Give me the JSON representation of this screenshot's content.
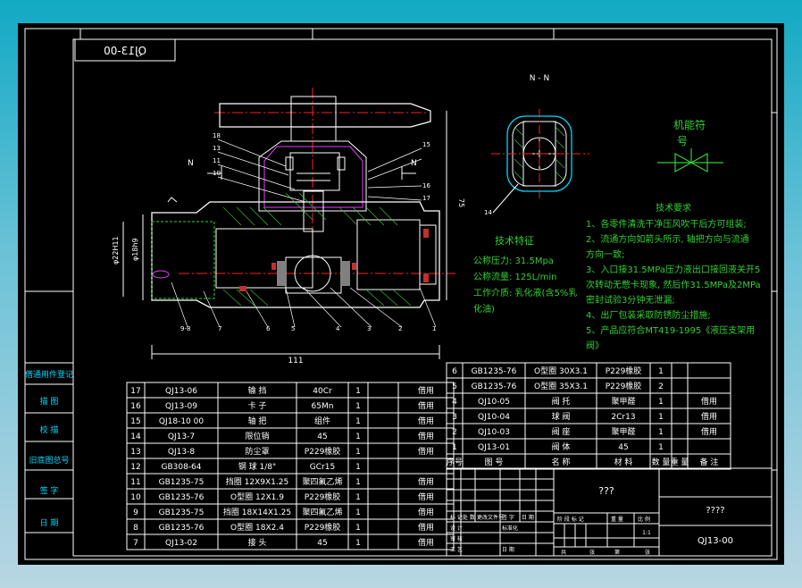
{
  "drawing_code": "QJ13-00",
  "drawing_code_mirrored": "QJ13-00",
  "section_label": "N - N",
  "cut_labels": {
    "left": "N",
    "right": "N"
  },
  "symbol_title_line1": "机能符",
  "symbol_title_line2": "号",
  "tech_features": {
    "title": "技术特征",
    "lines": [
      "公称压力: 31.5Mpa",
      "公称流量: 125L/min",
      "工作介质: 乳化液(含5%乳",
      "化油)"
    ]
  },
  "tech_requirements": {
    "title": "技术要求",
    "lines": [
      "1、各零件清洗干净压风吹干后方可组装;",
      "2、流通方向如箭头所示, 轴把方向与流通",
      "方向一致;",
      "3、入口接31.5MPa压力液出口接回液关开5",
      "次转动无憋卡现象, 然后作31.5MPa及2MPa",
      "密封试验3分钟无泄漏;",
      "4、出厂包装采取防锈防尘措施;",
      "5、产品应符合MT419-1995《液压支架用",
      "阀》"
    ]
  },
  "dimensions": {
    "overall_length": "111",
    "height": "75",
    "dia_outer": "φ22H11",
    "dia_inner": "φ18h9"
  },
  "balloons_top": [
    "18",
    "13",
    "11",
    "10",
    "15",
    "16",
    "17"
  ],
  "balloons_bottom": [
    "9-8",
    "7",
    "6",
    "5",
    "4",
    "3",
    "2",
    "1"
  ],
  "balloon_section": "14",
  "left_stamps": [
    "借通用件登记",
    "描 图",
    "校 描",
    "旧底图总号",
    "签 字",
    "日 期"
  ],
  "bom_left": [
    {
      "no": "17",
      "code": "QJ13-06",
      "name": "输 挡",
      "material": "40Cr",
      "qty": "1",
      "note": "借用"
    },
    {
      "no": "16",
      "code": "QJ13-09",
      "name": "卡 子",
      "material": "65Mn",
      "qty": "1",
      "note": "借用"
    },
    {
      "no": "15",
      "code": "QJ18-10 00",
      "name": "轴 把",
      "material": "组件",
      "qty": "1",
      "note": "借用"
    },
    {
      "no": "14",
      "code": "QJ13-7",
      "name": "限位销",
      "material": "45",
      "qty": "1",
      "note": "借用"
    },
    {
      "no": "13",
      "code": "QJ13-8",
      "name": "防尘罩",
      "material": "P229橡胶",
      "qty": "1",
      "note": "借用"
    },
    {
      "no": "12",
      "code": "GB308-64",
      "name": "钢 球 1/8\"",
      "material": "GCr15",
      "qty": "1",
      "note": ""
    },
    {
      "no": "11",
      "code": "GB1235-75",
      "name": "挡圈 12X9X1.25",
      "material": "聚四氟乙烯",
      "qty": "1",
      "note": "借用"
    },
    {
      "no": "10",
      "code": "GB1235-76",
      "name": "O型圈 12X1.9",
      "material": "P229橡胶",
      "qty": "1",
      "note": "借用"
    },
    {
      "no": "9",
      "code": "GB1235-75",
      "name": "挡圈 18X14X1.25",
      "material": "聚四氟乙烯",
      "qty": "1",
      "note": "借用"
    },
    {
      "no": "8",
      "code": "GB1235-76",
      "name": "O型圈 18X2.4",
      "material": "P229橡胶",
      "qty": "1",
      "note": "借用"
    },
    {
      "no": "7",
      "code": "QJ13-02",
      "name": "接 头",
      "material": "45",
      "qty": "1",
      "note": "借用"
    }
  ],
  "bom_right": [
    {
      "no": "6",
      "code": "GB1235-76",
      "name": "O型圈 30X3.1",
      "material": "P229橡胶",
      "qty": "1",
      "note": ""
    },
    {
      "no": "5",
      "code": "GB1235-76",
      "name": "O型圈 35X3.1",
      "material": "P229橡胶",
      "qty": "2",
      "note": ""
    },
    {
      "no": "4",
      "code": "QJ10-05",
      "name": "阀 托",
      "material": "聚甲醛",
      "qty": "1",
      "note": "借用"
    },
    {
      "no": "3",
      "code": "QJ10-04",
      "name": "球 阀",
      "material": "2Cr13",
      "qty": "1",
      "note": "借用"
    },
    {
      "no": "2",
      "code": "QJ10-03",
      "name": "阀 座",
      "material": "聚甲醛",
      "qty": "1",
      "note": "借用"
    },
    {
      "no": "1",
      "code": "QJ13-01",
      "name": "阀 体",
      "material": "45",
      "qty": "1",
      "note": ""
    }
  ],
  "bom_header": {
    "no": "序号",
    "code": "图 号",
    "name": "名  称",
    "material": "材 料",
    "qty": "数 量",
    "weight": "重 量",
    "note": "备 注"
  },
  "title_block": {
    "part_name": "???",
    "unit_name": "????",
    "code": "QJ13-00",
    "scale": "1:1",
    "row_labels": [
      "标 记",
      "处 数",
      "更改文件号",
      "签 字",
      "日 期"
    ],
    "role_labels": [
      "设 计",
      "标准化",
      "审 核",
      "工 艺",
      "日 期"
    ],
    "stage_labels": [
      "阶 段 标 记",
      "重 量",
      "比 例"
    ],
    "sheet_labels": [
      "共",
      "张",
      "第",
      "张"
    ]
  }
}
